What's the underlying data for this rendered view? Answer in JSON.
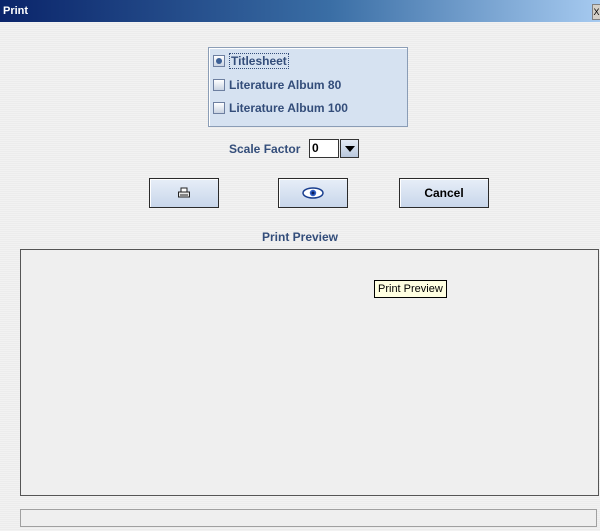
{
  "window": {
    "title": "Print",
    "close_glyph": "X"
  },
  "radio_group": {
    "options": [
      {
        "label": "Titlesheet",
        "checked": true
      },
      {
        "label": "Literature Album 80",
        "checked": false
      },
      {
        "label": "Literature Album 100",
        "checked": false
      }
    ]
  },
  "scale": {
    "label": "Scale Factor",
    "value": "0"
  },
  "buttons": {
    "print_icon": "printer-icon",
    "preview_icon": "eye-icon",
    "cancel_label": "Cancel"
  },
  "preview": {
    "section_label": "Print Preview",
    "tooltip": "Print Preview"
  },
  "colors": {
    "label_text": "#334d7a",
    "panel_bg": "#d6e2f1",
    "titlebar": "#0a246a"
  }
}
